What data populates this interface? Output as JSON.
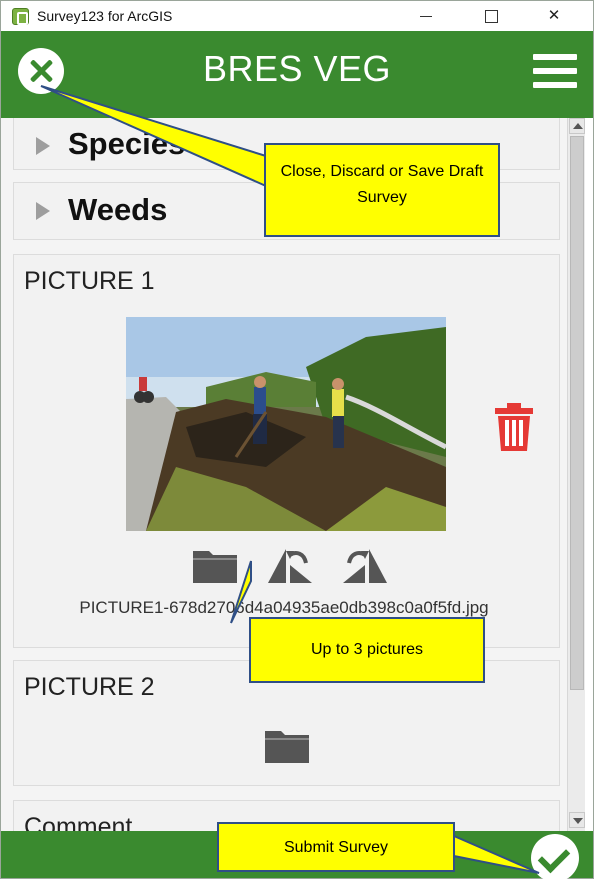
{
  "window": {
    "title": "Survey123 for ArcGIS",
    "minimize_glyph": "",
    "maximize_glyph": "",
    "close_glyph": "✕"
  },
  "header": {
    "title": "BRES VEG",
    "close_icon": "close-circle-icon",
    "menu_icon": "hamburger-menu-icon",
    "accent_color": "#3a8a2f"
  },
  "groups": [
    {
      "label": "Species"
    },
    {
      "label": "Weeds"
    }
  ],
  "picture1": {
    "label": "PICTURE 1",
    "filename": "PICTURE1-678d2706d4a04935ae0db398c0a0f5fd.jpg",
    "delete_icon": "trash-icon",
    "delete_color": "#e53935",
    "tools": [
      "folder-icon",
      "rotate-left-icon",
      "rotate-right-icon"
    ]
  },
  "picture2": {
    "label": "PICTURE 2",
    "tools": [
      "folder-icon"
    ]
  },
  "comment": {
    "label": "Comment"
  },
  "footer": {
    "submit_icon": "check-circle-icon"
  },
  "callouts": {
    "close": "Close, Discard or Save Draft Survey",
    "pictures": "Up to 3 pictures",
    "submit": "Submit Survey"
  }
}
